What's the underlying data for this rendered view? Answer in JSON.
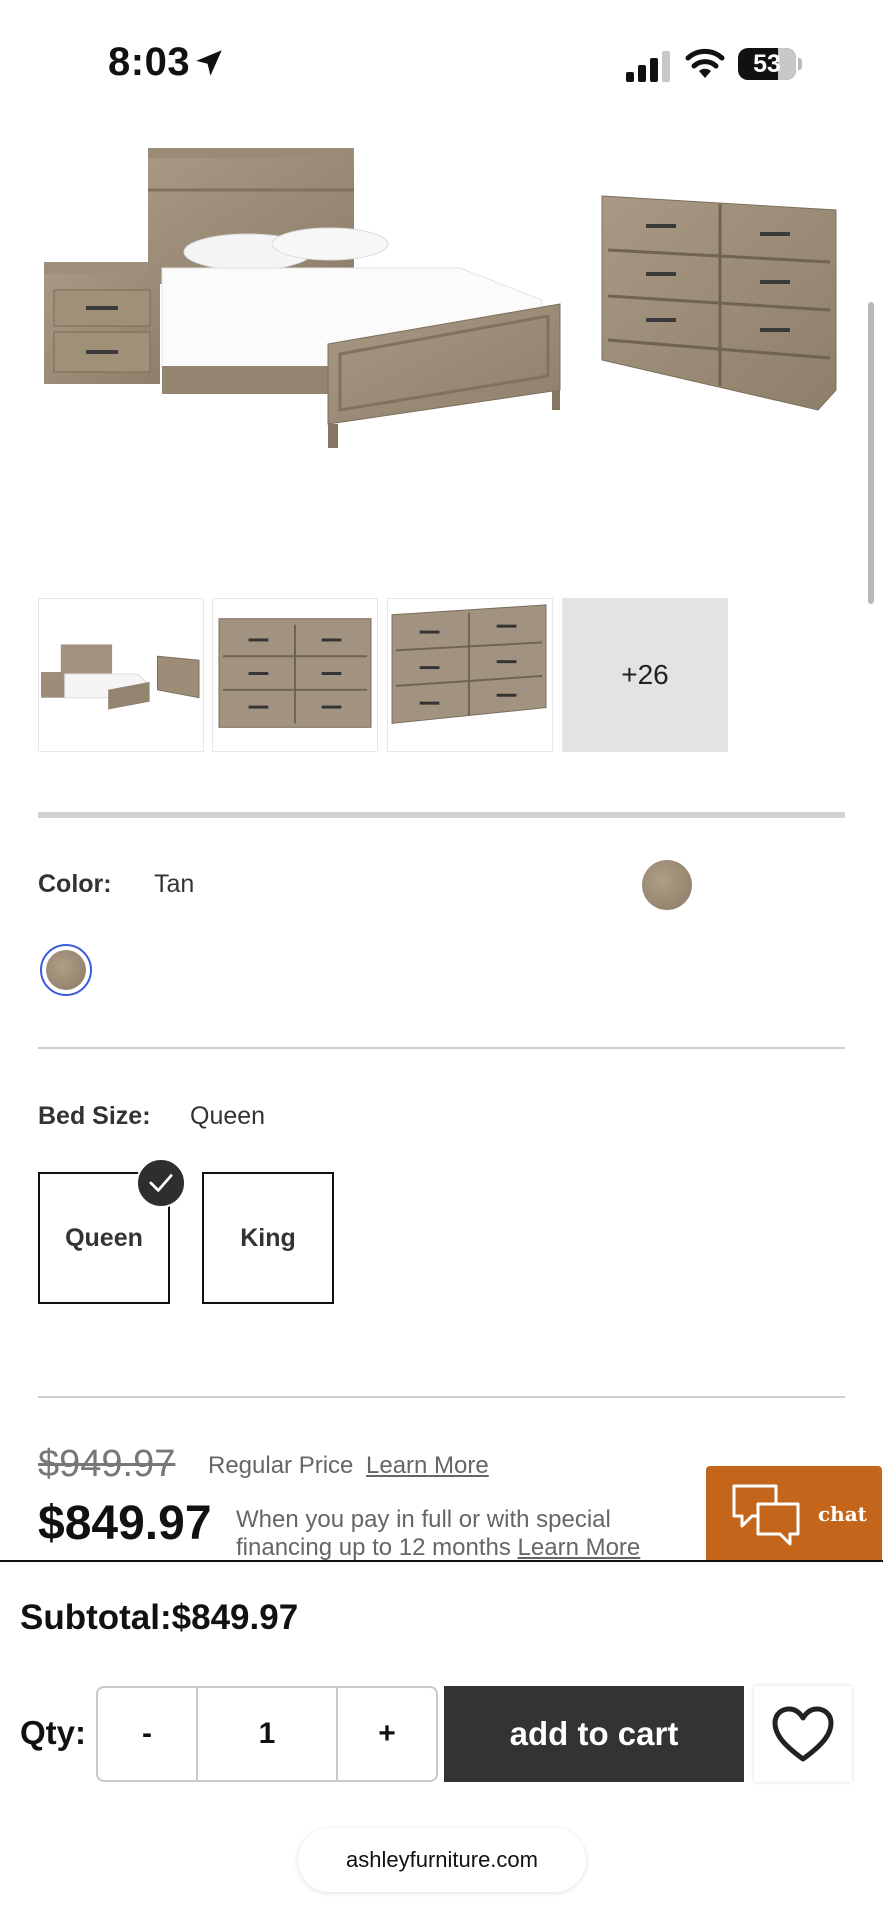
{
  "status_bar": {
    "time": "8:03",
    "battery": "53",
    "icons": [
      "location-arrow-icon",
      "cellular-signal-icon",
      "wifi-icon",
      "battery-icon"
    ]
  },
  "gallery": {
    "main_image": "bedroom set: panel bed, nightstand and dresser",
    "thumbnails": [
      "bedroom-set",
      "dresser-front",
      "dresser-angle"
    ],
    "more_count": "+26"
  },
  "color": {
    "label": "Color:",
    "value": "Tan",
    "swatch_color": "#9c8c75"
  },
  "bed_size": {
    "label": "Bed Size:",
    "value": "Queen",
    "options": [
      {
        "label": "Queen",
        "selected": true
      },
      {
        "label": "King",
        "selected": false
      }
    ]
  },
  "pricing": {
    "regular_price": "$949.97",
    "regular_label": "Regular Price",
    "learn_more": "Learn More",
    "sale_price": "$849.97",
    "finance_text": "When you pay in full or with special financing up to 12 months",
    "finance_learn_more": "Learn More"
  },
  "chat": {
    "label": "chat",
    "color": "#c3661c"
  },
  "cart": {
    "subtotal": "Subtotal:$849.97",
    "qty_label": "Qty:",
    "minus": "-",
    "qty": "1",
    "plus": "+",
    "add_to_cart": "add to cart"
  },
  "browser": {
    "url": "ashleyfurniture.com"
  }
}
